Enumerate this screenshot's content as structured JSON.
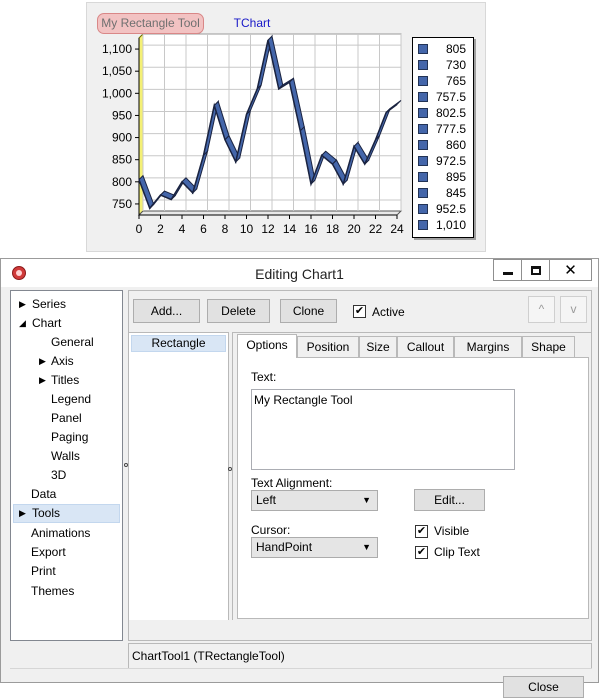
{
  "chart": {
    "tool_label": "My Rectangle Tool",
    "title": "TChart",
    "colors": {
      "series_fill": "#4466aa",
      "series_edge": "#1a2340",
      "wall": "#f4f075",
      "title": "#1818c8"
    },
    "legend": [
      "805",
      "730",
      "765",
      "757.5",
      "802.5",
      "777.5",
      "860",
      "972.5",
      "895",
      "845",
      "952.5",
      "1,010"
    ]
  },
  "chart_data": {
    "type": "line",
    "title": "TChart",
    "xlabel": "",
    "ylabel": "",
    "x": [
      0,
      1,
      2,
      3,
      4,
      5,
      6,
      7,
      8,
      9,
      10,
      11,
      12,
      13,
      14,
      15,
      16,
      17,
      18,
      19,
      20,
      21,
      22,
      23,
      24
    ],
    "series": [
      {
        "values": [
          805,
          740,
          770,
          760,
          800,
          775,
          860,
          972.5,
          895,
          845,
          952.5,
          1010,
          1120,
          1010,
          1025,
          915,
          795,
          860,
          840,
          795,
          880,
          840,
          895,
          957,
          975
        ]
      }
    ],
    "xlim": [
      0,
      24
    ],
    "ylim": [
      725,
      1125
    ],
    "x_ticks": [
      "0",
      "2",
      "4",
      "6",
      "8",
      "10",
      "12",
      "14",
      "16",
      "18",
      "20",
      "22",
      "24"
    ],
    "y_ticks": [
      "750",
      "800",
      "850",
      "900",
      "950",
      "1,000",
      "1,050",
      "1,100"
    ],
    "grid": true,
    "style": "3d",
    "legend_position": "right"
  },
  "dialog": {
    "title": "Editing Chart1",
    "window_buttons": {
      "close_glyph": "✕"
    },
    "tree": {
      "items": [
        {
          "label": "Series",
          "arrow": "▶"
        },
        {
          "label": "Chart",
          "arrow": "◢"
        },
        {
          "label": "General"
        },
        {
          "label": "Axis",
          "arrow": "▶"
        },
        {
          "label": "Titles",
          "arrow": "▶"
        },
        {
          "label": "Legend"
        },
        {
          "label": "Panel"
        },
        {
          "label": "Paging"
        },
        {
          "label": "Walls"
        },
        {
          "label": "3D"
        },
        {
          "label": "Data"
        },
        {
          "label": "Tools",
          "arrow": "▶"
        },
        {
          "label": "Animations"
        },
        {
          "label": "Export"
        },
        {
          "label": "Print"
        },
        {
          "label": "Themes"
        }
      ]
    },
    "toolbar": {
      "add": "Add...",
      "delete": "Delete",
      "clone": "Clone",
      "active": "Active",
      "active_checked": "✔",
      "up": "^",
      "down": "v"
    },
    "tools_list": [
      "Rectangle"
    ],
    "tabs": [
      "Options",
      "Position",
      "Size",
      "Callout",
      "Margins",
      "Shape"
    ],
    "options": {
      "text_label": "Text:",
      "text_value": "My Rectangle Tool",
      "alignment_label": "Text Alignment:",
      "alignment_value": "Left",
      "edit_button": "Edit...",
      "cursor_label": "Cursor:",
      "cursor_value": "HandPoint",
      "visible_label": "Visible",
      "clip_text_label": "Clip Text",
      "check_glyph": "✔",
      "dropdown_glyph": "▼"
    },
    "status": "ChartTool1 (TRectangleTool)",
    "close_button": "Close"
  }
}
